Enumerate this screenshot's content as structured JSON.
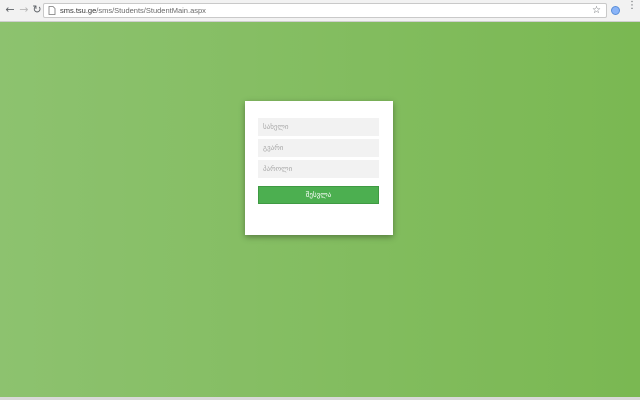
{
  "browser": {
    "url_host": "sms.tsu.ge",
    "url_path": "/sms/Students/StudentMain.aspx",
    "icons": {
      "back": "back-arrow-icon",
      "forward": "forward-arrow-icon",
      "reload": "reload-icon",
      "star": "star-icon",
      "extension": "extension-icon",
      "menu": "menu-icon"
    }
  },
  "colors": {
    "page_gradient_start": "#8dc26f",
    "page_gradient_end": "#7ab852",
    "button": "#4caf50"
  },
  "login_form": {
    "fields": [
      {
        "name": "სახელი",
        "placeholder": "სახელი"
      },
      {
        "name": "გვარი",
        "placeholder": "გვარი"
      },
      {
        "name": "პაროლი",
        "placeholder": "პაროლი"
      }
    ],
    "submit_label": "შესვლა"
  }
}
